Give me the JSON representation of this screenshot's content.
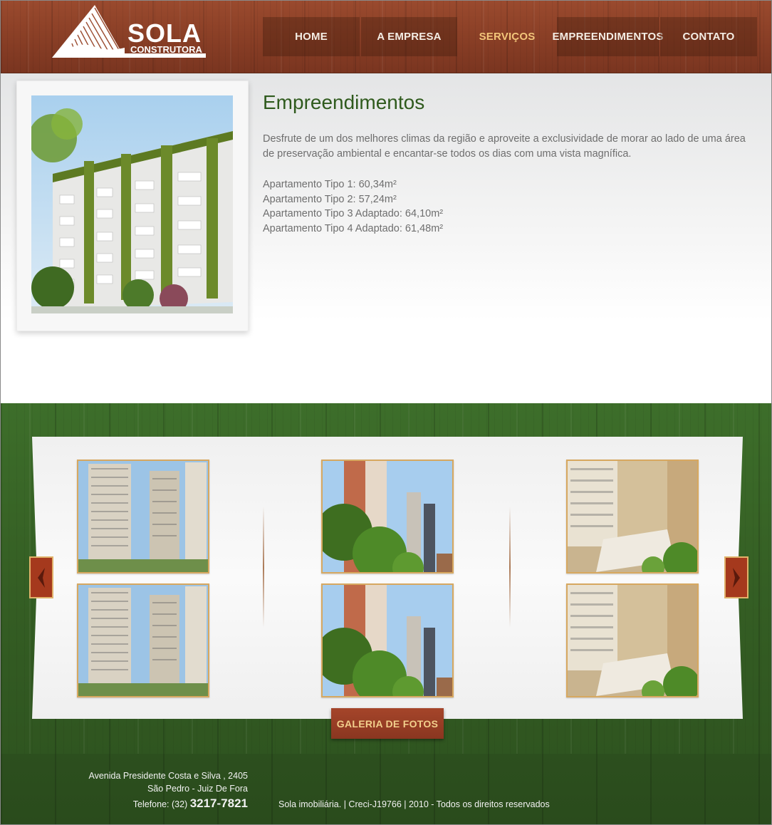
{
  "header": {
    "logo": {
      "name": "SOLA",
      "subtitle": "CONSTRUTORA"
    },
    "nav": [
      {
        "label": "HOME",
        "active": false
      },
      {
        "label": "A EMPRESA",
        "active": false
      },
      {
        "label": "SERVIÇOS",
        "active": true
      },
      {
        "label": "EMPREENDIMENTOS",
        "active": false
      },
      {
        "label": "CONTATO",
        "active": false
      }
    ]
  },
  "main": {
    "title": "Empreendimentos",
    "description": "Desfrute de um dos melhores climas da região e aproveite a exclusividade de morar ao lado de uma área de preservação ambiental e encantar-se todos os dias com uma vista magnífica.",
    "specs": [
      "Apartamento Tipo 1: 60,34m²",
      "Apartamento Tipo 2: 57,24m²",
      "Apartamento Tipo 3 Adaptado: 64,10m²",
      "Apartamento Tipo 4 Adaptado: 61,48m²"
    ]
  },
  "gallery": {
    "button_label": "GALERIA DE FOTOS",
    "prev_icon": "chevron-left-icon",
    "next_icon": "chevron-right-icon"
  },
  "footer": {
    "address_line1": "Avenida Presidente Costa e Silva ,  2405",
    "address_line2": "São Pedro  - Juiz De Fora",
    "phone_label": "Telefone: (32)",
    "phone_number": "3217-7821",
    "copyright": "Sola imobiliária. | Creci-J19766 | 2010 - Todos os direitos reservados"
  },
  "colors": {
    "header_wood": "#8a3f26",
    "nav_active": "#f2c57a",
    "title_green": "#2f5a1d",
    "gallery_green": "#355f24",
    "thumb_border": "#d7a860"
  }
}
